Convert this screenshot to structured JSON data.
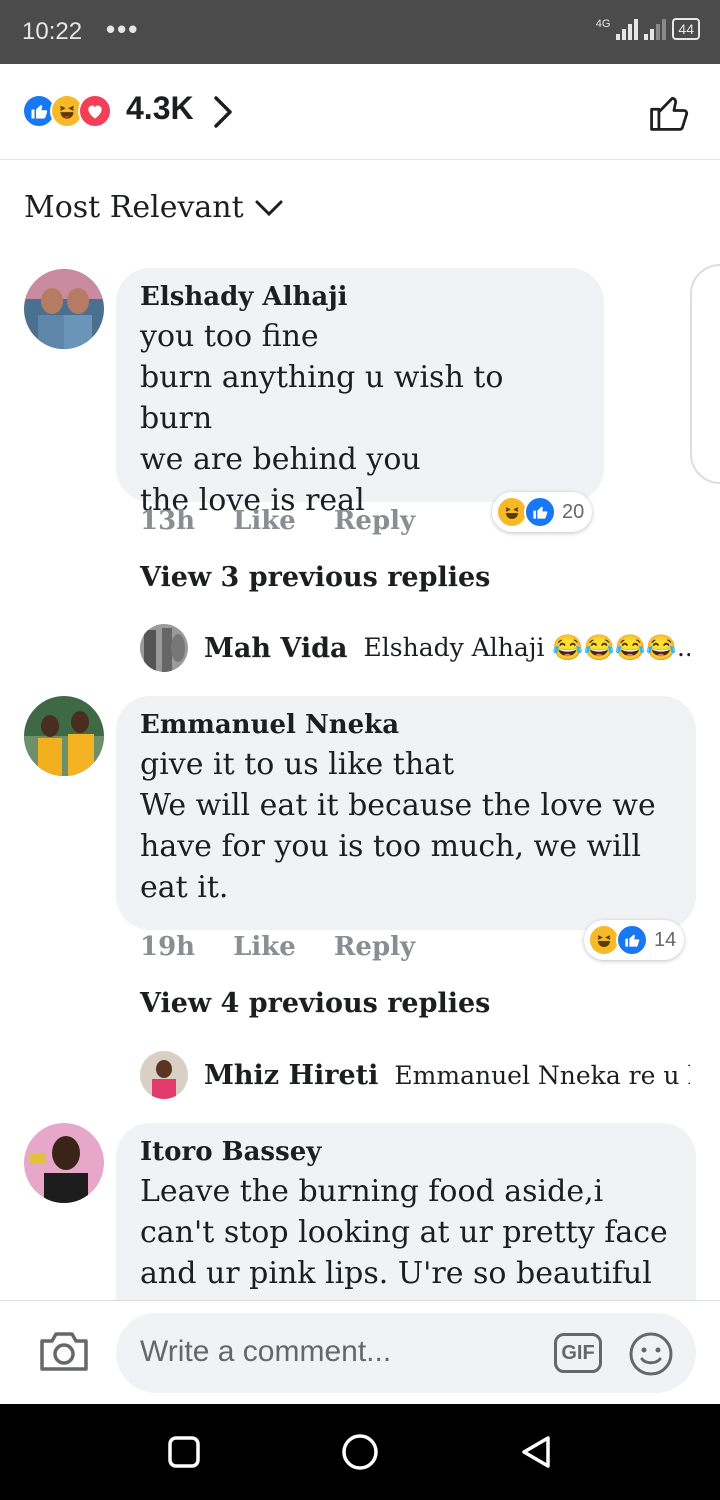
{
  "status_bar": {
    "time": "10:22",
    "dots": "•••",
    "network": "4G",
    "battery": "44"
  },
  "header": {
    "reaction_count": "4.3K",
    "reaction_icons": [
      "like-icon",
      "haha-icon",
      "love-icon"
    ]
  },
  "sort": {
    "label": "Most Relevant"
  },
  "comments": [
    {
      "author": "Elshady Alhaji",
      "text": "you too fine\nburn anything u wish to burn\nwe are behind you\nthe love is real",
      "time": "13h",
      "like_label": "Like",
      "reply_label": "Reply",
      "reaction_count": "20",
      "view_replies": "View 3 previous replies",
      "latest_reply": {
        "name": "Mah Vida",
        "text": "Elshady Alhaji 😂😂😂😂..."
      }
    },
    {
      "author": "Emmanuel Nneka",
      "text": "give it to us like that\nWe will eat it because the love we have for you is too much, we will eat it.",
      "time": "19h",
      "like_label": "Like",
      "reply_label": "Reply",
      "reaction_count": "14",
      "view_replies": "View 4 previous replies",
      "latest_reply": {
        "name": "Mhiz Hireti",
        "text": "Emmanuel Nneka re u he..."
      }
    },
    {
      "author": "Itoro Bassey",
      "text": "Leave the burning food aside,i can't stop looking at ur pretty face and ur pink lips. U're so beautiful"
    }
  ],
  "composer": {
    "placeholder": "Write a comment...",
    "gif_label": "GIF"
  },
  "colors": {
    "accent": "#1877f2",
    "bubble": "#f0f2f5",
    "meta": "#8a8d91",
    "haha": "#f7b928",
    "love": "#f33e58"
  }
}
